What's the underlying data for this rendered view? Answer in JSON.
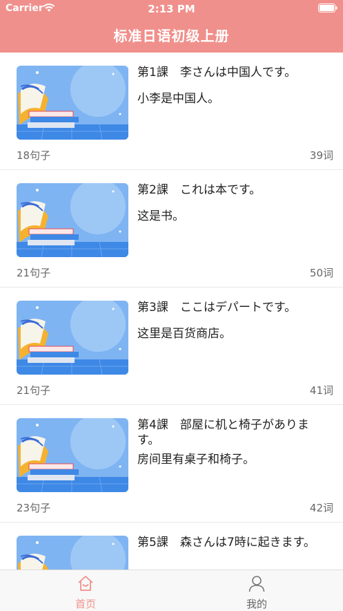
{
  "status_bar": {
    "carrier": "Carrier",
    "time": "2:13 PM"
  },
  "nav": {
    "title": "标准日语初级上册"
  },
  "lessons": [
    {
      "title": "第1課　李さんは中国人です。",
      "subtitle": "小李是中国人。",
      "sentences": "18句子",
      "words": "39词"
    },
    {
      "title": "第2課　これは本です。",
      "subtitle": "这是书。",
      "sentences": "21句子",
      "words": "50词"
    },
    {
      "title": "第3課　ここはデパートです。",
      "subtitle": "这里是百货商店。",
      "sentences": "21句子",
      "words": "41词"
    },
    {
      "title": "第4課　部屋に机と椅子があります。",
      "subtitle": "房间里有桌子和椅子。",
      "sentences": "23句子",
      "words": "42词"
    },
    {
      "title": "第5課　森さんは7時に起きます。",
      "subtitle": "",
      "sentences": "",
      "words": ""
    }
  ],
  "tabbar": {
    "home": {
      "label": "首页",
      "icon": "home-icon",
      "active": true
    },
    "mine": {
      "label": "我的",
      "icon": "person-icon",
      "active": false
    }
  },
  "colors": {
    "accent": "#f0908c",
    "thumb_bg": "#7fb4f2"
  }
}
